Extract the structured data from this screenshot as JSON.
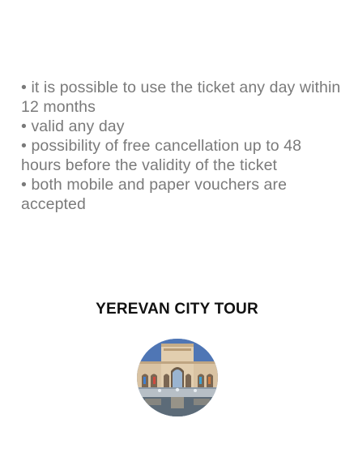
{
  "features": [
    "•  it is possible to use the ticket any day within 12 months",
    "•  valid any day",
    "• possibility of free cancellation up to 48 hours before the validity of the ticket",
    "• both mobile and paper vouchers are accepted"
  ],
  "tour": {
    "title": "YEREVAN CITY TOUR",
    "image_icon": "museum-building-photo"
  }
}
